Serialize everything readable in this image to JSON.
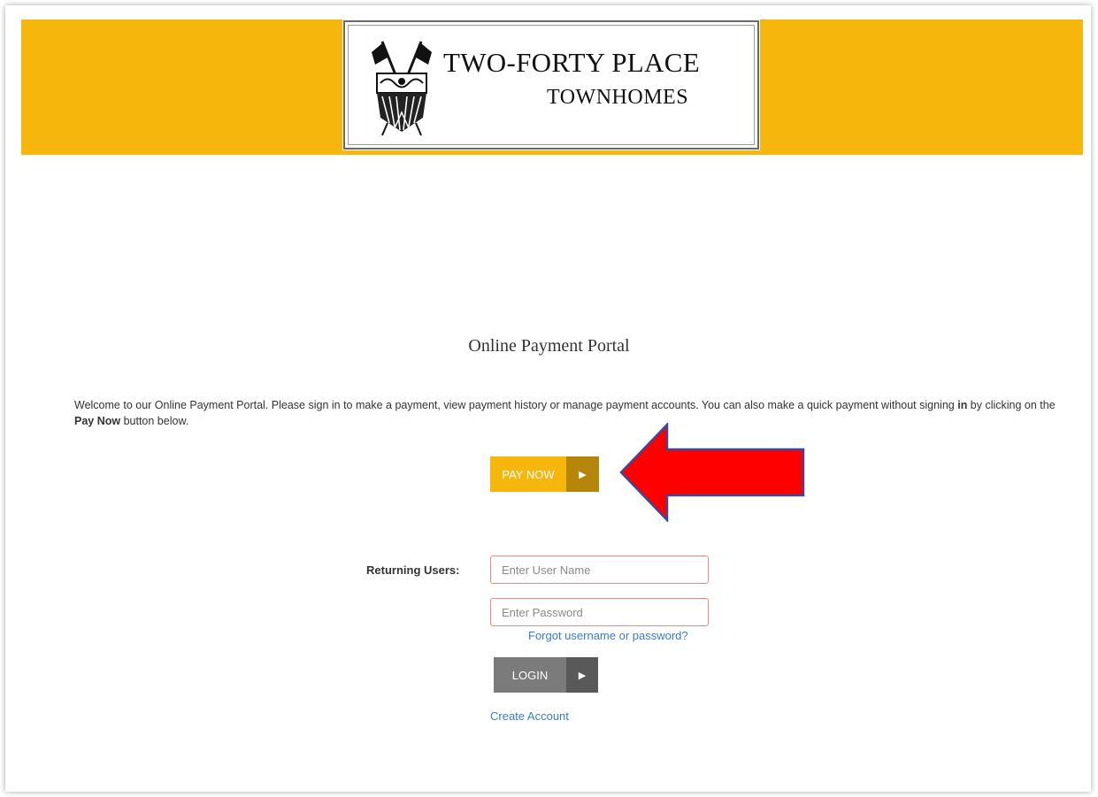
{
  "header": {
    "logo_line1": "TWO-FORTY PLACE",
    "logo_line2": "TOWNHOMES",
    "band_color": "#f6b60b"
  },
  "main": {
    "title": "Online Payment Portal",
    "welcome_part1": "Welcome to our Online Payment Portal. Please sign in to make a payment, view payment history or manage payment accounts. You can also make a quick payment without signing ",
    "welcome_bold_in": "in",
    "welcome_part2": " by clicking on the ",
    "welcome_bold_paynow": "Pay Now",
    "welcome_part3": " button below.",
    "pay_now_label": "PAY NOW",
    "arrow_glyph": "▶"
  },
  "login": {
    "returning_label": "Returning Users:",
    "username_placeholder": "Enter User Name",
    "password_placeholder": "Enter Password",
    "forgot_link": "Forgot username or password?",
    "login_label": "LOGIN",
    "create_account": "Create Account"
  },
  "colors": {
    "accent": "#f6b60b",
    "accent_dark": "#b58609",
    "link": "#3a7cc4",
    "annotation_arrow": "#ff0000"
  }
}
